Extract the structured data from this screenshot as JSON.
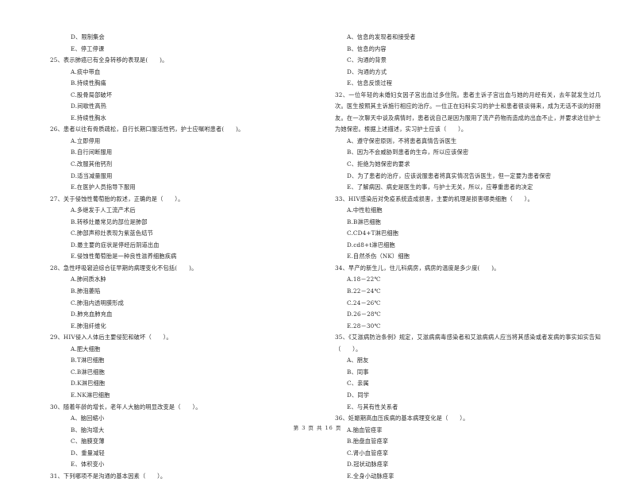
{
  "left_column": [
    {
      "type": "option",
      "text": "D、限制集会"
    },
    {
      "type": "option",
      "text": "E、停工停课"
    },
    {
      "type": "question",
      "text": "25、表示肺癌已有全身转移的表现是(　　)。"
    },
    {
      "type": "option",
      "text": "A.痰中带血"
    },
    {
      "type": "option",
      "text": "B.持续性胸痛"
    },
    {
      "type": "option",
      "text": "C.股骨局部破坏"
    },
    {
      "type": "option",
      "text": "D.间歇性高热"
    },
    {
      "type": "option",
      "text": "E.持续性胸水"
    },
    {
      "type": "question",
      "text": "26、患者以往有骨质疏松，自行长期口服活性钙，护士应嘱咐患者(　　)。"
    },
    {
      "type": "option",
      "text": "A.立即停用"
    },
    {
      "type": "option",
      "text": "B.自行间断服用"
    },
    {
      "type": "option",
      "text": "C.改服其他钙剂"
    },
    {
      "type": "option",
      "text": "D.适当减量服用"
    },
    {
      "type": "option",
      "text": "E.在医护人员指导下服用"
    },
    {
      "type": "question",
      "text": "27、关于侵蚀性葡萄胎的叙述，正确的是（　　）。"
    },
    {
      "type": "option",
      "text": "A.多继发于人工流产术后"
    },
    {
      "type": "option",
      "text": "B.转移灶最常见的部位是肺部"
    },
    {
      "type": "option",
      "text": "C.肺部声称灶表现为紫蓝色结节"
    },
    {
      "type": "option",
      "text": "D.最主要的症状是停经后阴道出血"
    },
    {
      "type": "option",
      "text": "E.侵蚀性葡萄胎是一种良性滋养细胞疾病"
    },
    {
      "type": "question",
      "text": "28、急性呼吸窘迫综合征早期的病理变化不包括(　　)。"
    },
    {
      "type": "option",
      "text": "A.肺间质水肿"
    },
    {
      "type": "option",
      "text": "B.肺泡萎陷"
    },
    {
      "type": "option",
      "text": "C.肺泡内透明膜形成"
    },
    {
      "type": "option",
      "text": "D.肺充血肺充血"
    },
    {
      "type": "option",
      "text": "E.肺泡纤维化"
    },
    {
      "type": "question",
      "text": "29、HIV侵入人体后主要侵犯和破坏（　　）。"
    },
    {
      "type": "option",
      "text": "A.肥大细胞"
    },
    {
      "type": "option",
      "text": "B.T淋巴细胞"
    },
    {
      "type": "option",
      "text": "C.B淋巴细胞"
    },
    {
      "type": "option",
      "text": "D.K淋巴细胞"
    },
    {
      "type": "option",
      "text": "E.NK淋巴细胞"
    },
    {
      "type": "question",
      "text": "30、随着年龄的增长，老年人大脑的明显改变是（　　）。"
    },
    {
      "type": "option",
      "text": "A、脑回缩小"
    },
    {
      "type": "option",
      "text": "B、脑沟增大"
    },
    {
      "type": "option",
      "text": "C、脑膜变薄"
    },
    {
      "type": "option",
      "text": "D、重量减轻"
    },
    {
      "type": "option",
      "text": "E、体积变小"
    },
    {
      "type": "question",
      "text": "31、下列哪项不是沟通的基本因素（　　）。"
    }
  ],
  "right_column": [
    {
      "type": "option",
      "text": "A、信息的发现者和接受者"
    },
    {
      "type": "option",
      "text": "B、信息的内容"
    },
    {
      "type": "option",
      "text": "C、沟通的背景"
    },
    {
      "type": "option",
      "text": "D、沟通的方式"
    },
    {
      "type": "option",
      "text": "E、信息反馈过程"
    },
    {
      "type": "question_wrap",
      "lines": 4,
      "text": "32、一位年轻的未婚妇女因子宫出血过多住院。患者主诉子宫出血与她的月经有关，去年就发生过几次。医生按照其主诉施行相应的治疗。一位正在妇科实习的护士和患者很谈得来，成为无话不谈的好朋友。在一次聊天中谈及病情时，患者说自己是因为服用了流产药物而造成的出血不止，并要求这位护士为她保密。根据上述描述，实习护士应该（　　）。"
    },
    {
      "type": "option",
      "text": "A、遵守保密原则，不将患者真情告诉医生"
    },
    {
      "type": "option",
      "text": "B、因为不会威胁到患者的生命，所以应该保密"
    },
    {
      "type": "option",
      "text": "C、拒绝为她保密的要求"
    },
    {
      "type": "option",
      "text": "D、为了患者的治疗，应该说服患者将真实情况告诉医生，但一定要为患者保密"
    },
    {
      "type": "option",
      "text": "E、了解病因、病史是医生的事，与护士无关，所以，应尊重患者的决定"
    },
    {
      "type": "question",
      "text": "33、HIV感染后对免疫系统造成损害，主要的机理是损害哪类细胞（　　）。"
    },
    {
      "type": "option",
      "text": "A.中性粒细胞"
    },
    {
      "type": "option",
      "text": "B.B淋巴细胞"
    },
    {
      "type": "option",
      "text": "C.CD4+T淋巴细胞"
    },
    {
      "type": "option",
      "text": "D.cd8+t淋巴细胞"
    },
    {
      "type": "option",
      "text": "E.自然杀伤（NK）细胞"
    },
    {
      "type": "question",
      "text": "34、早产的新生儿，住儿科病房，病房的温度是多少度(　　)。"
    },
    {
      "type": "option",
      "text": "A.18－22℃"
    },
    {
      "type": "option",
      "text": "B.22－24℃"
    },
    {
      "type": "option",
      "text": "C.24－26℃"
    },
    {
      "type": "option",
      "text": "D.26－28℃"
    },
    {
      "type": "option",
      "text": "E.28－30℃"
    },
    {
      "type": "question_wrap",
      "lines": 2,
      "text": "35、《艾滋病防治条例》规定，艾滋病病毒感染者和艾滋病病人应当将其感染或者发病的事实如实告知（　　）。"
    },
    {
      "type": "option",
      "text": "A、朋友"
    },
    {
      "type": "option",
      "text": "B、同事"
    },
    {
      "type": "option",
      "text": "C、亲属"
    },
    {
      "type": "option",
      "text": "D、同学"
    },
    {
      "type": "option",
      "text": "E、与其有性关系者"
    },
    {
      "type": "question",
      "text": "36、妊娠期高血压疾病的基本病理变化是（　　）。"
    },
    {
      "type": "option",
      "text": "A.脑血管痉挛"
    },
    {
      "type": "option",
      "text": "B.胎盘血管痉挛"
    },
    {
      "type": "option",
      "text": "C.肾小血管痉挛"
    },
    {
      "type": "option",
      "text": "D.冠状动脉痉挛"
    },
    {
      "type": "option",
      "text": "E.全身小动脉痉挛"
    }
  ],
  "footer": {
    "page_label": "第 3 页 共 16 页"
  }
}
